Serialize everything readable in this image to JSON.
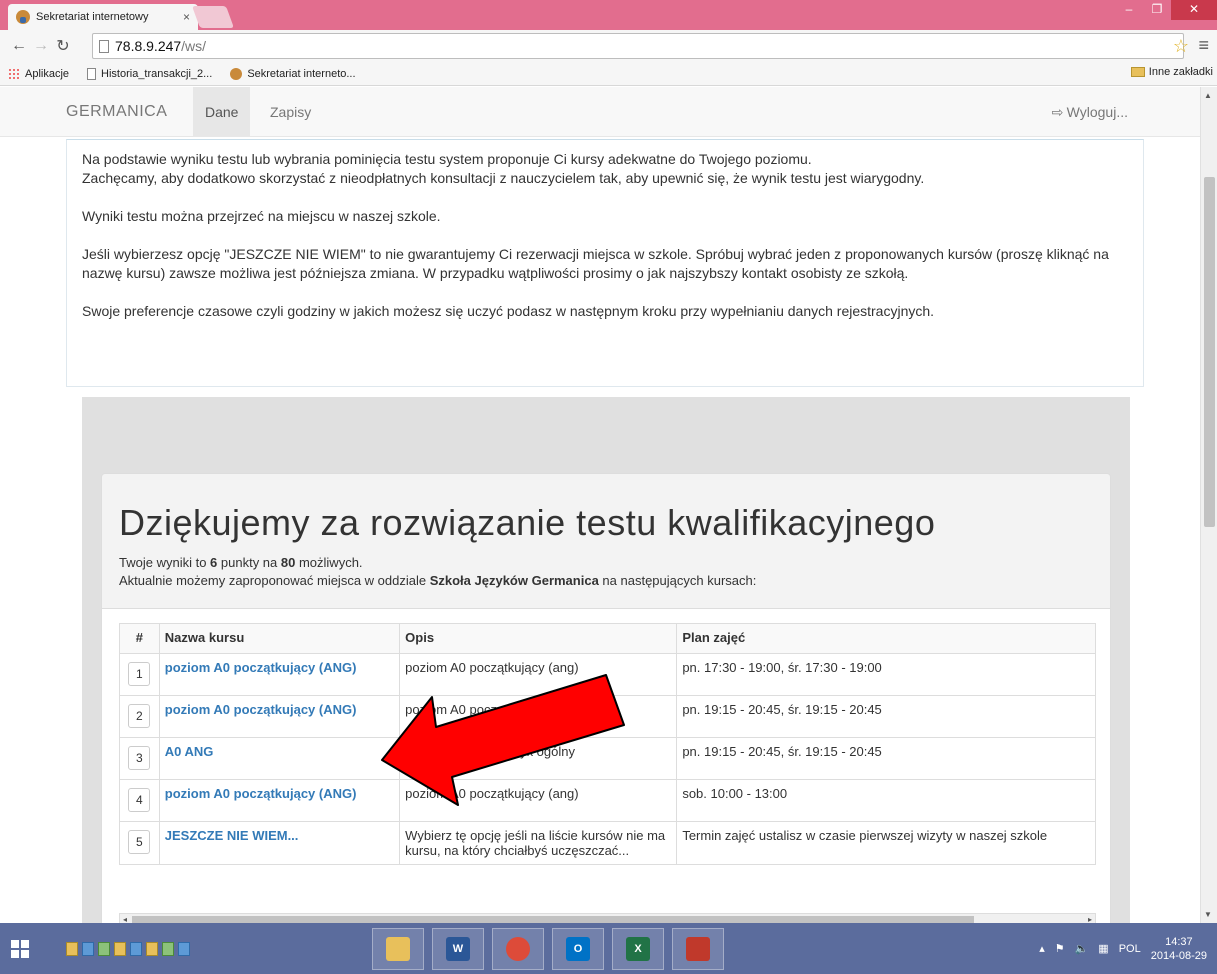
{
  "browser": {
    "tab_title": "Sekretariat internetowy",
    "tab_close": "×",
    "url_host": "78.8.9.247",
    "url_path": "/ws/",
    "bookmarks": [
      "Aplikacje",
      "Historia_transakcji_2...",
      "Sekretariat interneto..."
    ],
    "other_bookmarks": "Inne zakładki"
  },
  "navbar": {
    "brand": "GERMANICA",
    "items": [
      {
        "label": "Dane",
        "active": true
      },
      {
        "label": "Zapisy",
        "active": false
      }
    ],
    "logout": "Wyloguj..."
  },
  "info": {
    "p1_line1": "Na podstawie wyniku testu lub wybrania pominięcia testu system proponuje Ci kursy adekwatne do Twojego poziomu.",
    "p1_line2": "Zachęcamy, aby dodatkowo skorzystać z nieodpłatnych konsultacji z nauczycielem tak, aby upewnić się, że wynik testu jest wiarygodny.",
    "p2": "Wyniki testu można przejrzeć na miejscu w naszej szkole.",
    "p3": "Jeśli wybierzesz opcję \"JESZCZE NIE WIEM\" to nie gwarantujemy Ci rezerwacji miejsca w szkole. Spróbuj wybrać jeden z proponowanych kursów (proszę kliknąć na nazwę kursu) zawsze możliwa jest późniejsza zmiana. W przypadku wątpliwości prosimy o jak najszybszy kontakt osobisty ze szkołą.",
    "p4": "Swoje preferencje czasowe czyli godziny w jakich możesz się uczyć podasz w następnym kroku przy wypełnianiu danych rejestracyjnych."
  },
  "result": {
    "heading": "Dziękujemy za rozwiązanie testu kwalifikacyjnego",
    "score_prefix": "Twoje wyniki to ",
    "score": "6",
    "score_mid": " punkty na ",
    "max": "80",
    "score_suffix": " możliwych.",
    "branch_prefix": "Aktualnie możemy zaproponować miejsca w oddziale ",
    "branch": "Szkoła Języków Germanica",
    "branch_suffix": " na następujących kursach:"
  },
  "table": {
    "headers": [
      "#",
      "Nazwa kursu",
      "Opis",
      "Plan zajęć"
    ],
    "rows": [
      {
        "num": "1",
        "name": "poziom A0 początkujący (ANG)",
        "desc": "poziom A0 początkujący (ang)",
        "plan": "pn. 17:30 - 19:00, śr. 17:30 - 19:00"
      },
      {
        "num": "2",
        "name": "poziom A0 początkujący (ANG)",
        "desc": "poziom A0 początkujący (ang)",
        "plan": "pn. 19:15 - 20:45, śr. 19:15 - 20:45"
      },
      {
        "num": "3",
        "name": "A0 ANG",
        "desc": "A0 początkujący język ogólny",
        "plan": "pn. 19:15 - 20:45, śr. 19:15 - 20:45"
      },
      {
        "num": "4",
        "name": "poziom A0 początkujący (ANG)",
        "desc": "poziom A0 początkujący (ang)",
        "plan": "sob. 10:00 - 13:00"
      },
      {
        "num": "5",
        "name": "JESZCZE NIE WIEM...",
        "desc": "Wybierz tę opcję jeśli na liście kursów nie ma kursu, na który chciałbyś uczęszczać...",
        "plan": "Termin zajęć ustalisz w czasie pierwszej wizyty w naszej szkole"
      }
    ]
  },
  "taskbar": {
    "lang": "POL",
    "time": "14:37",
    "date": "2014-08-29",
    "apps": [
      "W",
      "",
      "O",
      "X",
      ""
    ]
  },
  "colors": {
    "titlebar": "#e26d8e",
    "link": "#337ab7",
    "arrow": "#ff0000",
    "taskbar": "#5b6c9d"
  }
}
